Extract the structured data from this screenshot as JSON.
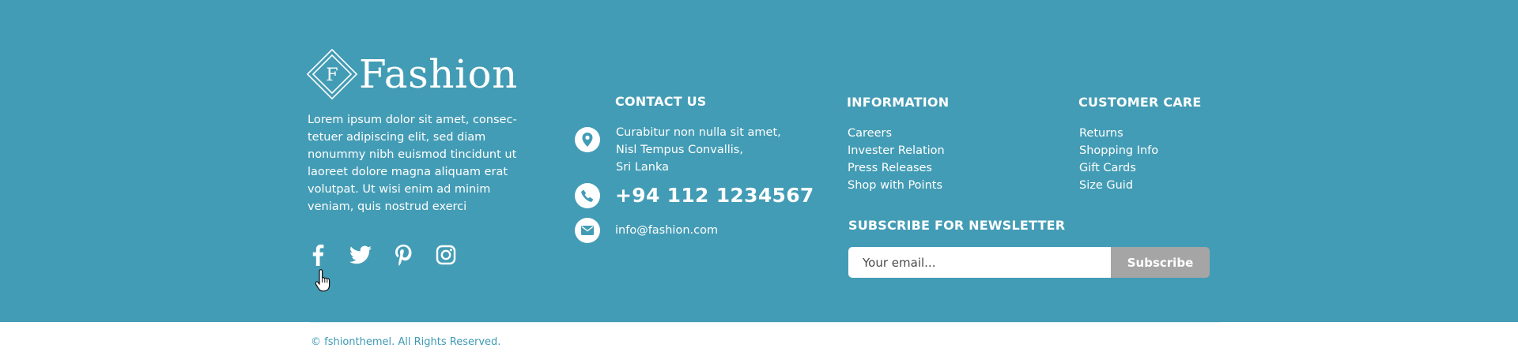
{
  "brand": {
    "logo_letter": "F",
    "name": "Fashion"
  },
  "about": {
    "text": "Lorem ipsum dolor sit amet, consec-tetuer adipiscing elit, sed diam nonummy nibh euismod tincidunt ut laoreet dolore magna aliquam erat volutpat. Ut wisi enim ad minim veniam, quis nostrud exerci"
  },
  "social": {
    "icons": [
      "facebook-icon",
      "twitter-icon",
      "pinterest-icon",
      "instagram-icon"
    ]
  },
  "contact": {
    "title": "CONTACT US",
    "address": [
      "Curabitur non nulla sit amet,",
      "Nisl Tempus Convallis,",
      "Sri Lanka"
    ],
    "phone": "+94 112 1234567",
    "email": "info@fashion.com"
  },
  "information": {
    "title": "INFORMATION",
    "links": [
      "Careers",
      "Invester Relation",
      "Press Releases",
      "Shop with Points"
    ]
  },
  "customer_care": {
    "title": "CUSTOMER CARE",
    "links": [
      "Returns",
      "Shopping Info",
      "Gift Cards",
      "Size Guid"
    ]
  },
  "newsletter": {
    "title": "SUBSCRIBE FOR NEWSLETTER",
    "placeholder": "Your email...",
    "button_label": "Subscribe"
  },
  "footer_bottom": {
    "copyright": "© fshionthemel. All Rights Reserved."
  },
  "colors": {
    "footer_bg": "#439cb5",
    "accent_text": "#3d9ab3",
    "button_bg": "#a5a5a5"
  }
}
